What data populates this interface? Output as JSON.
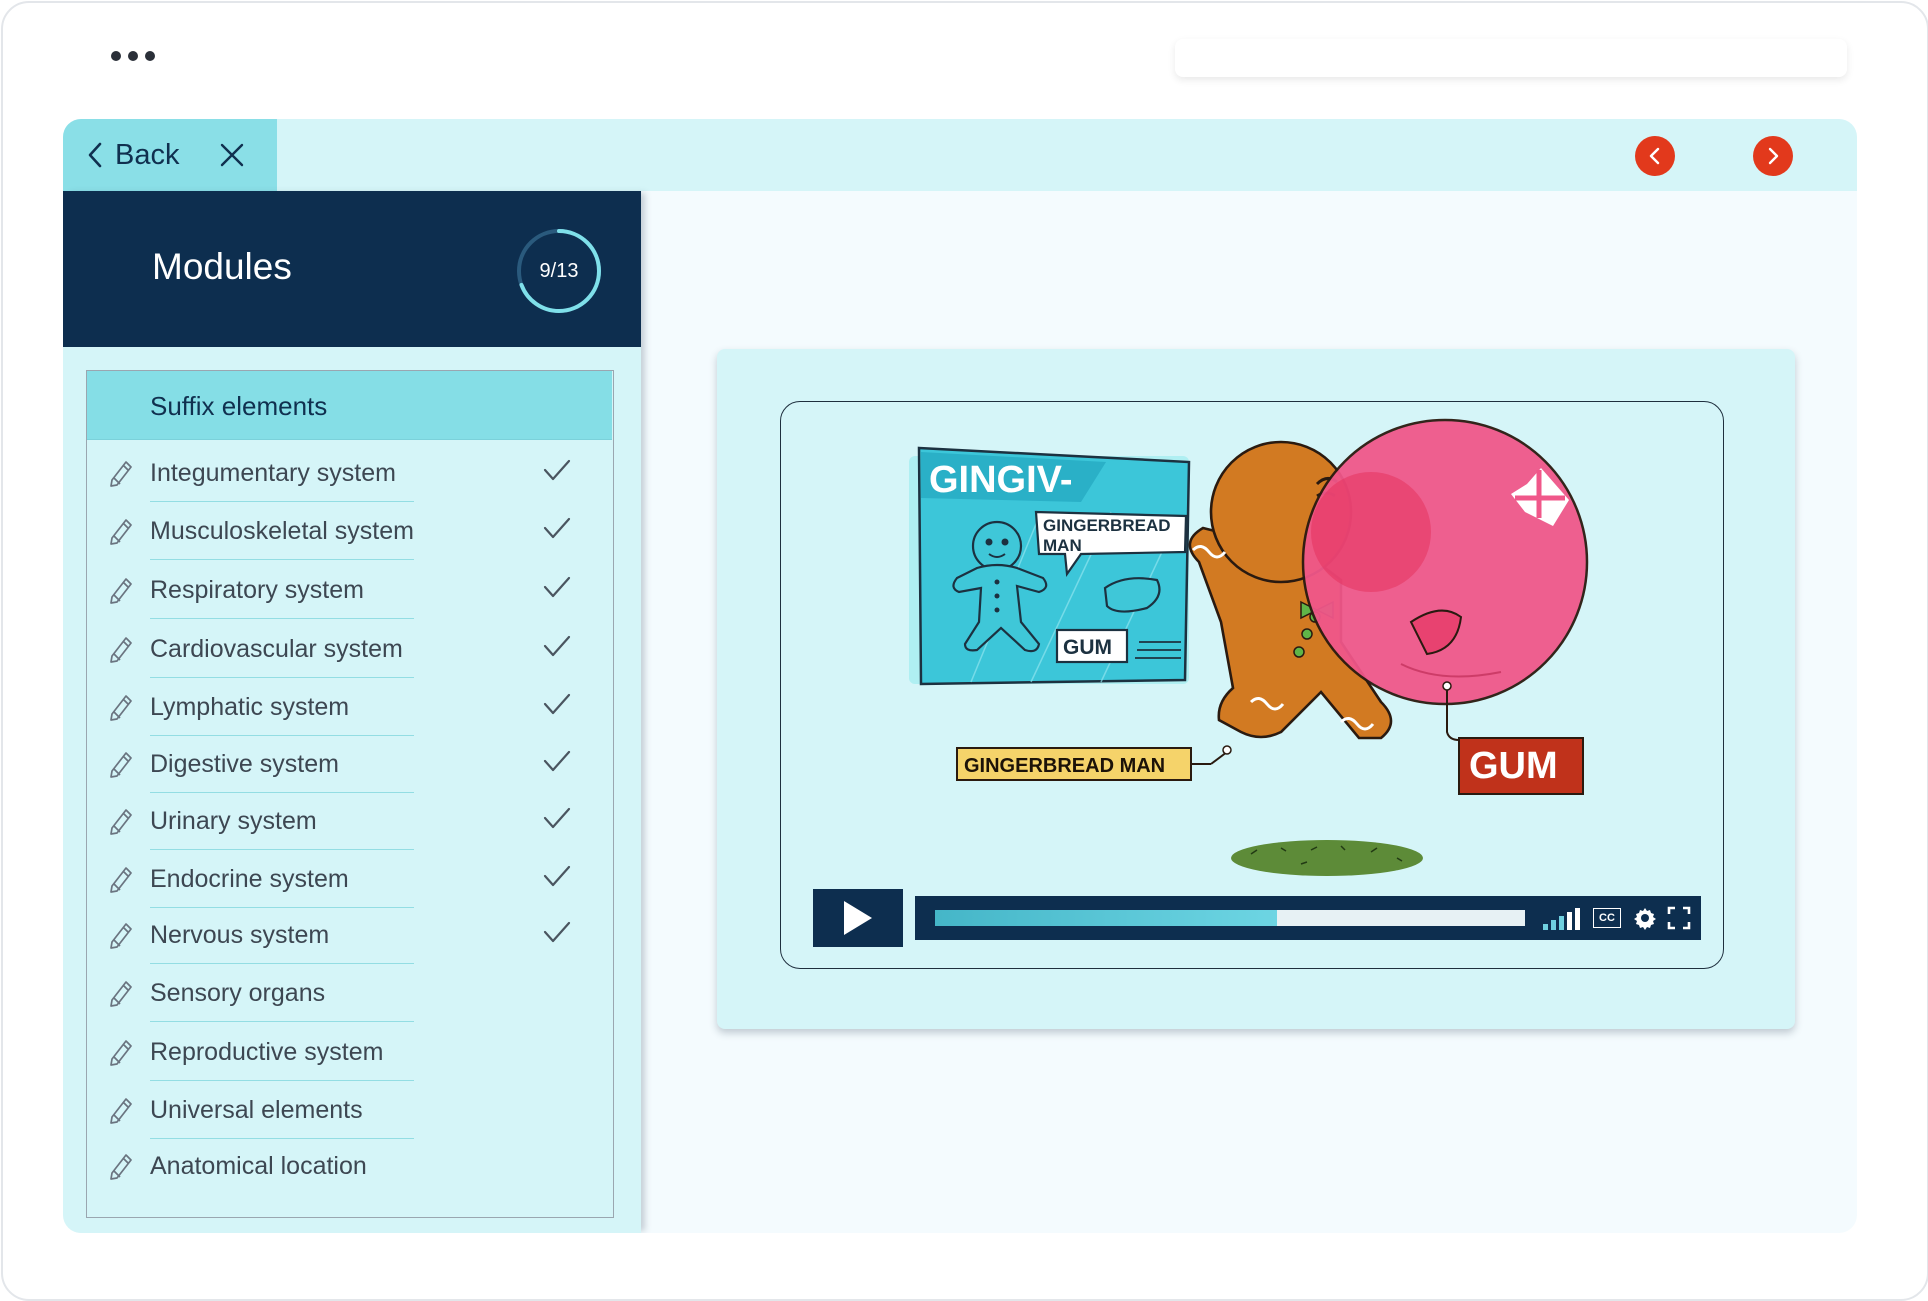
{
  "header": {
    "back_label": "Back"
  },
  "sidebar": {
    "title": "Modules",
    "progress": {
      "label": "9/13",
      "current": 9,
      "total": 13
    },
    "section_header": "Suffix elements",
    "items": [
      {
        "label": "Integumentary system",
        "completed": true
      },
      {
        "label": "Musculoskeletal system",
        "completed": true
      },
      {
        "label": "Respiratory system",
        "completed": true
      },
      {
        "label": "Cardiovascular system",
        "completed": true
      },
      {
        "label": "Lymphatic system",
        "completed": true
      },
      {
        "label": "Digestive system",
        "completed": true
      },
      {
        "label": "Urinary system",
        "completed": true
      },
      {
        "label": "Endocrine system",
        "completed": true
      },
      {
        "label": "Nervous system",
        "completed": true
      },
      {
        "label": "Sensory organs",
        "completed": false
      },
      {
        "label": "Reproductive system",
        "completed": false
      },
      {
        "label": "Universal elements",
        "completed": false
      },
      {
        "label": "Anatomical location",
        "completed": false
      }
    ]
  },
  "video": {
    "illustration": {
      "card_title": "GINGIV-",
      "card_speech": "GINGERBREAD MAN",
      "card_tag": "GUM",
      "label_left": "GINGERBREAD MAN",
      "label_right": "GUM"
    },
    "progress_fraction": 0.58,
    "cc_label": "CC"
  },
  "colors": {
    "navy": "#0d2e4f",
    "aqua_light": "#d5f5f8",
    "aqua_tab": "#8adfe7",
    "accent_red": "#e2391c",
    "gum_pink": "#f0578a"
  },
  "icons": {
    "back": "chevron-left-icon",
    "close": "close-icon",
    "prev": "chevron-left-icon",
    "next": "chevron-right-icon",
    "item": "pencil-icon",
    "done": "check-icon",
    "play": "play-icon",
    "volume": "volume-bars-icon",
    "captions": "cc-icon",
    "settings": "gear-icon",
    "fullscreen": "fullscreen-icon"
  }
}
